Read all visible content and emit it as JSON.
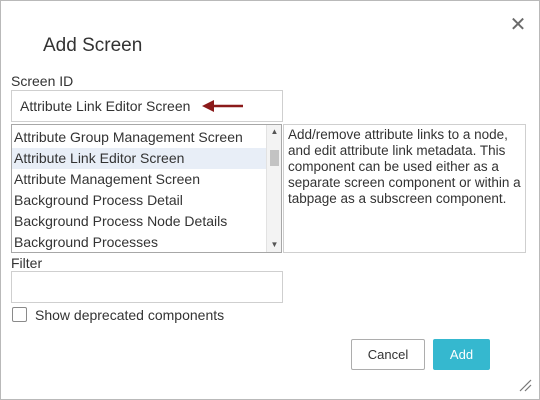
{
  "dialog": {
    "title": "Add Screen",
    "close_glyph": "✕",
    "close_icon": "close-icon"
  },
  "screen_id": {
    "label": "Screen ID",
    "value": "Attribute Link Editor Screen",
    "annotation_color": "#8b1a1a"
  },
  "component_list": {
    "items": [
      {
        "label": "Attribute Group Management Screen",
        "selected": false
      },
      {
        "label": "Attribute Link Editor Screen",
        "selected": true
      },
      {
        "label": "Attribute Management Screen",
        "selected": false
      },
      {
        "label": "Background Process Detail",
        "selected": false
      },
      {
        "label": "Background Process Node Details",
        "selected": false
      },
      {
        "label": "Background Processes",
        "selected": false
      }
    ],
    "scroll_up_glyph": "▲",
    "scroll_down_glyph": "▼"
  },
  "description": {
    "text": "Add/remove attribute links to a node, and edit attribute link metadata. This component can be used either as a separate screen component or within a tabpage as a subscreen component."
  },
  "filter": {
    "label": "Filter",
    "value": ""
  },
  "show_deprecated": {
    "label": "Show deprecated components",
    "checked": false
  },
  "buttons": {
    "cancel_label": "Cancel",
    "add_label": "Add",
    "add_color": "#35b8cf"
  }
}
